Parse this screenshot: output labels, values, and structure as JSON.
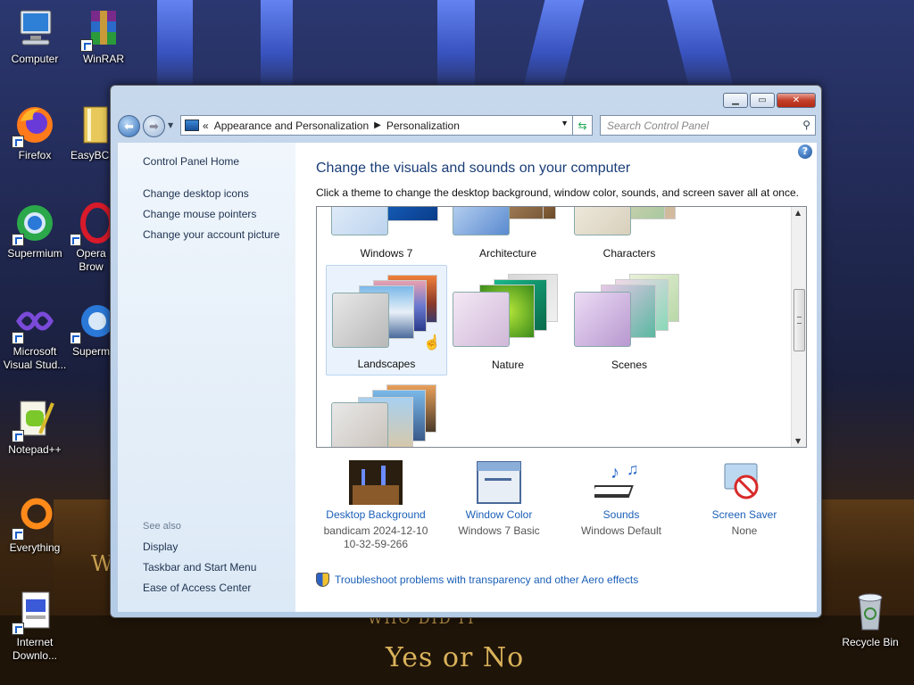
{
  "desktop": {
    "icons": [
      {
        "label": "Computer",
        "icon": "computer-icon"
      },
      {
        "label": "WinRAR",
        "icon": "winrar-icon"
      },
      {
        "label": "Firefox",
        "icon": "firefox-icon"
      },
      {
        "label": "EasyBCD",
        "icon": "easybcd-icon"
      },
      {
        "label": "Supermium",
        "icon": "supermium-icon"
      },
      {
        "label": "Opera Brow",
        "icon": "opera-icon"
      },
      {
        "label": "Microsoft Visual Stud...",
        "icon": "visual-studio-icon"
      },
      {
        "label": "Superm",
        "icon": "supermium-icon"
      },
      {
        "label": "Notepad++",
        "icon": "notepad-plus-plus-icon"
      },
      {
        "label": "Everything",
        "icon": "everything-icon"
      },
      {
        "label": "Internet Downlo...",
        "icon": "internet-download-manager-icon"
      },
      {
        "label": "Recycle Bin",
        "icon": "recycle-bin-icon"
      }
    ],
    "wallpaper_text": {
      "line1": "Yes or No",
      "line2": "WHO DID IT",
      "line3": "W"
    }
  },
  "window": {
    "caption_buttons": {
      "minimize": "minimize",
      "maximize": "maximize",
      "close": "close"
    },
    "address": {
      "prefix": "«",
      "crumbs": [
        "Appearance and Personalization",
        "Personalization"
      ]
    },
    "search": {
      "placeholder": "Search Control Panel"
    },
    "help": "?",
    "sidebar": {
      "home": "Control Panel Home",
      "links": [
        "Change desktop icons",
        "Change mouse pointers",
        "Change your account picture"
      ],
      "see_also_heading": "See also",
      "see_also": [
        "Display",
        "Taskbar and Start Menu",
        "Ease of Access Center"
      ]
    },
    "main": {
      "title": "Change the visuals and sounds on your computer",
      "subtitle": "Click a theme to change the desktop background, window color, sounds, and screen saver all at once.",
      "themes": [
        "Windows 7",
        "Architecture",
        "Characters",
        "Landscapes",
        "Nature",
        "Scenes"
      ],
      "selected_theme": "Landscapes",
      "bottom_items": [
        {
          "name": "Desktop Background",
          "value": "bandicam 2024-12-10 10-32-59-266",
          "icon": "desktop-background-icon"
        },
        {
          "name": "Window Color",
          "value": "Windows 7 Basic",
          "icon": "window-color-icon"
        },
        {
          "name": "Sounds",
          "value": "Windows Default",
          "icon": "sounds-icon"
        },
        {
          "name": "Screen Saver",
          "value": "None",
          "icon": "screen-saver-icon"
        }
      ],
      "troubleshoot": "Troubleshoot problems with transparency and other Aero effects"
    }
  },
  "colors": {
    "link": "#1b5fb8",
    "title": "#1a3d78",
    "close_button": "#c3402a"
  }
}
